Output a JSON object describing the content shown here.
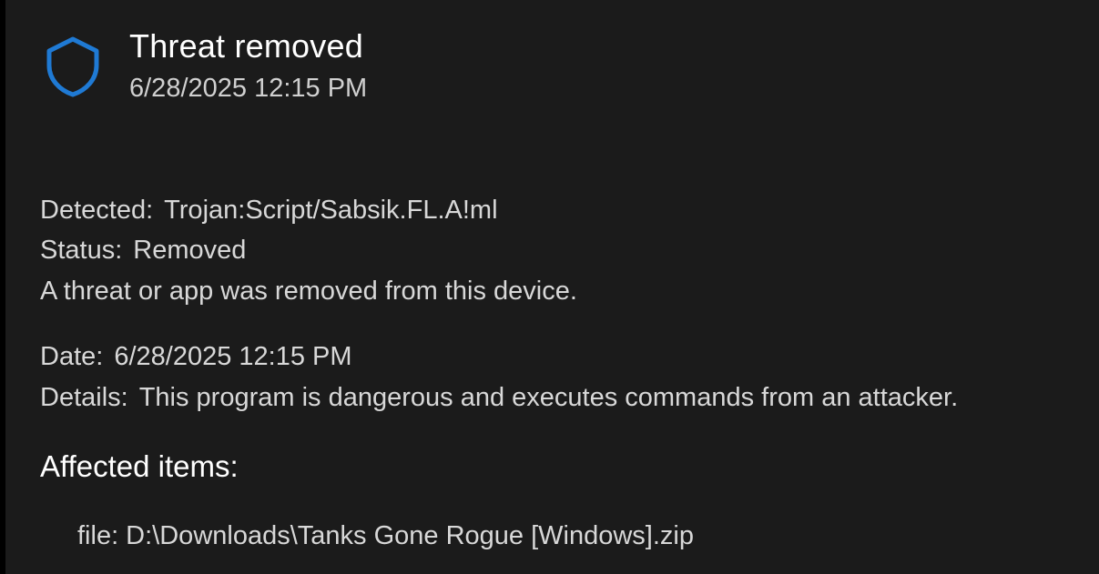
{
  "header": {
    "icon": "shield-icon",
    "title": "Threat removed",
    "timestamp": "6/28/2025 12:15 PM"
  },
  "details": {
    "detected_label": "Detected:",
    "detected_value": "Trojan:Script/Sabsik.FL.A!ml",
    "status_label": "Status:",
    "status_value": "Removed",
    "description": "A threat or app was removed from this device.",
    "date_label": "Date:",
    "date_value": "6/28/2025 12:15 PM",
    "details_label": "Details:",
    "details_value": "This program is dangerous and executes commands from an attacker."
  },
  "affected": {
    "heading": "Affected items:",
    "items": [
      "file: D:\\Downloads\\Tanks Gone Rogue [Windows].zip"
    ]
  },
  "colors": {
    "background": "#1b1b1b",
    "accent": "#1f7ad4",
    "text": "#e6e6e6"
  }
}
